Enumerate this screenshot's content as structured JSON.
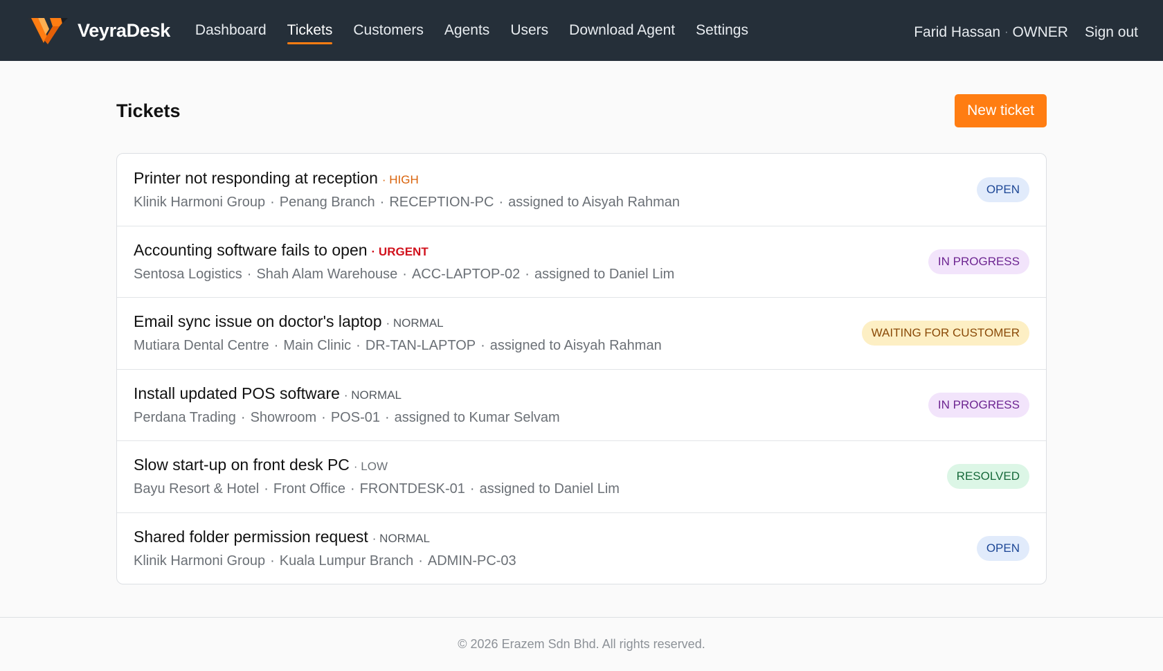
{
  "header": {
    "brand": "VeyraDesk",
    "nav": [
      {
        "label": "Dashboard",
        "active": false
      },
      {
        "label": "Tickets",
        "active": true
      },
      {
        "label": "Customers",
        "active": false
      },
      {
        "label": "Agents",
        "active": false
      },
      {
        "label": "Users",
        "active": false
      },
      {
        "label": "Download Agent",
        "active": false
      },
      {
        "label": "Settings",
        "active": false
      }
    ],
    "user_name": "Farid Hassan",
    "user_separator": "·",
    "user_role": "OWNER",
    "sign_out": "Sign out"
  },
  "page": {
    "title": "Tickets",
    "new_ticket_label": "New ticket"
  },
  "meta_separator": "·",
  "tickets": [
    {
      "title": "Printer not responding at reception",
      "priority": "· HIGH",
      "priority_level": "high",
      "customer": "Klinik Harmoni Group",
      "site": "Penang Branch",
      "device": "RECEPTION-PC",
      "assignee": "assigned to Aisyah Rahman",
      "status": "OPEN",
      "status_type": "open"
    },
    {
      "title": "Accounting software fails to open",
      "priority": "· URGENT",
      "priority_level": "urgent",
      "customer": "Sentosa Logistics",
      "site": "Shah Alam Warehouse",
      "device": "ACC-LAPTOP-02",
      "assignee": "assigned to Daniel Lim",
      "status": "IN PROGRESS",
      "status_type": "progress"
    },
    {
      "title": "Email sync issue on doctor's laptop",
      "priority": "· NORMAL",
      "priority_level": "normal",
      "customer": "Mutiara Dental Centre",
      "site": "Main Clinic",
      "device": "DR-TAN-LAPTOP",
      "assignee": "assigned to Aisyah Rahman",
      "status": "WAITING FOR CUSTOMER",
      "status_type": "waiting"
    },
    {
      "title": "Install updated POS software",
      "priority": "· NORMAL",
      "priority_level": "normal",
      "customer": "Perdana Trading",
      "site": "Showroom",
      "device": "POS-01",
      "assignee": "assigned to Kumar Selvam",
      "status": "IN PROGRESS",
      "status_type": "progress"
    },
    {
      "title": "Slow start-up on front desk PC",
      "priority": "· LOW",
      "priority_level": "low",
      "customer": "Bayu Resort & Hotel",
      "site": "Front Office",
      "device": "FRONTDESK-01",
      "assignee": "assigned to Daniel Lim",
      "status": "RESOLVED",
      "status_type": "resolved"
    },
    {
      "title": "Shared folder permission request",
      "priority": "· NORMAL",
      "priority_level": "normal",
      "customer": "Klinik Harmoni Group",
      "site": "Kuala Lumpur Branch",
      "device": "ADMIN-PC-03",
      "assignee": null,
      "status": "OPEN",
      "status_type": "open"
    }
  ],
  "footer": {
    "copyright": "© 2026 Erazem Sdn Bhd. All rights reserved."
  },
  "colors": {
    "nav_bg": "#252f39",
    "accent": "#ff7d12",
    "priority_high": "#d9620a",
    "priority_urgent": "#d1121d",
    "status_open": "#e1ebfb",
    "status_progress": "#f2e4fb",
    "status_waiting": "#fdefc4",
    "status_resolved": "#dcf6e6"
  },
  "icons": {
    "brand_logo": "brand-logo-icon"
  }
}
